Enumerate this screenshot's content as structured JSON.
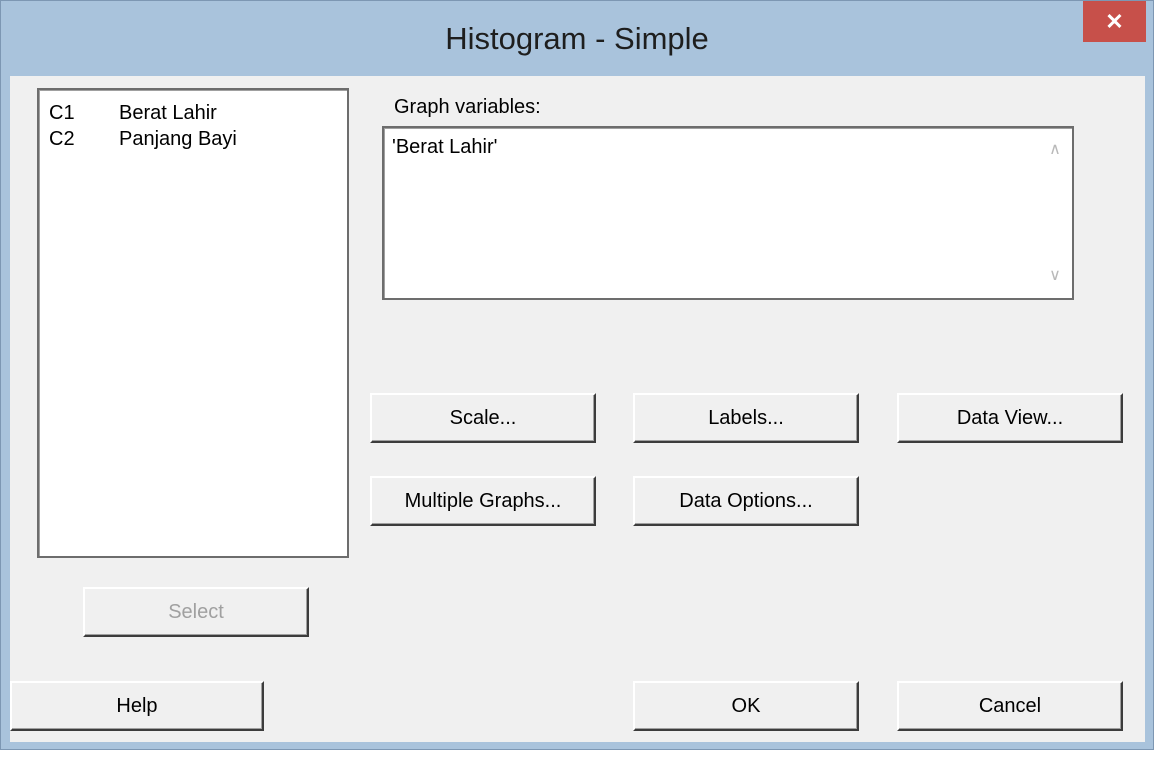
{
  "window": {
    "title": "Histogram - Simple",
    "close_glyph": "✕"
  },
  "variable_list": {
    "items": [
      {
        "col": "C1",
        "name": "Berat Lahir"
      },
      {
        "col": "C2",
        "name": "Panjang Bayi"
      }
    ]
  },
  "graph_variables": {
    "label": "Graph variables:",
    "value": "'Berat Lahir'",
    "scroll_up_icon": "chevron-up-icon",
    "scroll_down_icon": "chevron-down-icon"
  },
  "buttons": {
    "scale": "Scale...",
    "labels": "Labels...",
    "data_view": "Data View...",
    "multiple_graphs": "Multiple Graphs...",
    "data_options": "Data Options...",
    "select": "Select",
    "help": "Help",
    "ok": "OK",
    "cancel": "Cancel"
  },
  "colors": {
    "titlebar": "#a9c3dc",
    "close": "#c7504a",
    "client": "#f0f0f0"
  }
}
